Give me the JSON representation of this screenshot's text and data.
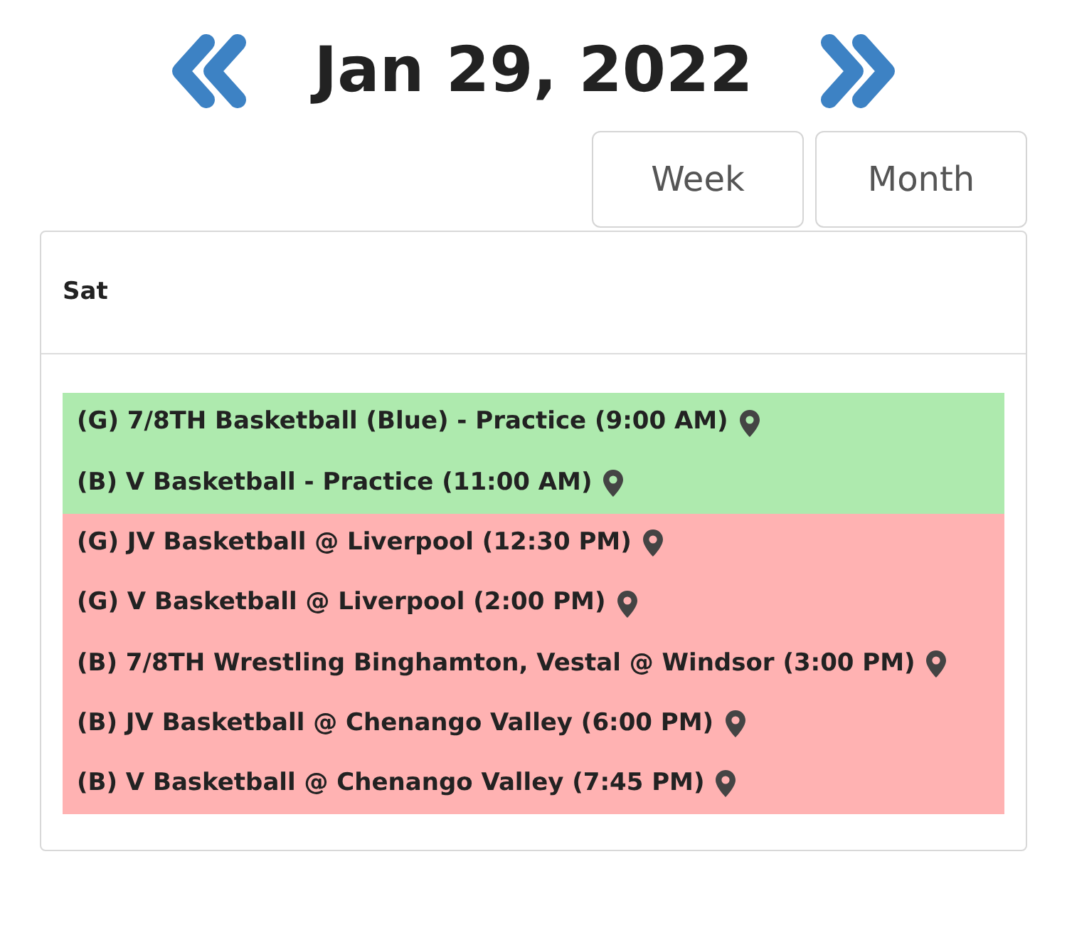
{
  "header": {
    "date": "Jan 29, 2022"
  },
  "views": [
    {
      "label": "Week",
      "selected": false
    },
    {
      "label": "Month",
      "selected": false
    }
  ],
  "day": {
    "label": "Sat"
  },
  "events": [
    {
      "text": "(G) 7/8TH Basketball (Blue) - Practice (9:00 AM)",
      "color": "#aeeaae"
    },
    {
      "text": "(B) V Basketball - Practice (11:00 AM)",
      "color": "#aeeaae"
    },
    {
      "text": "(G) JV Basketball @ Liverpool (12:30 PM)",
      "color": "#ffb2b2"
    },
    {
      "text": "(G) V Basketball @ Liverpool (2:00 PM)",
      "color": "#ffb2b2"
    },
    {
      "text": "(B) 7/8TH Wrestling Binghamton, Vestal @ Windsor (3:00 PM)",
      "color": "#ffb2b2"
    },
    {
      "text": "(B) JV Basketball @ Chenango Valley (6:00 PM)",
      "color": "#ffb2b2"
    },
    {
      "text": "(B) V Basketball @ Chenango Valley (7:45 PM)",
      "color": "#ffb2b2"
    }
  ]
}
